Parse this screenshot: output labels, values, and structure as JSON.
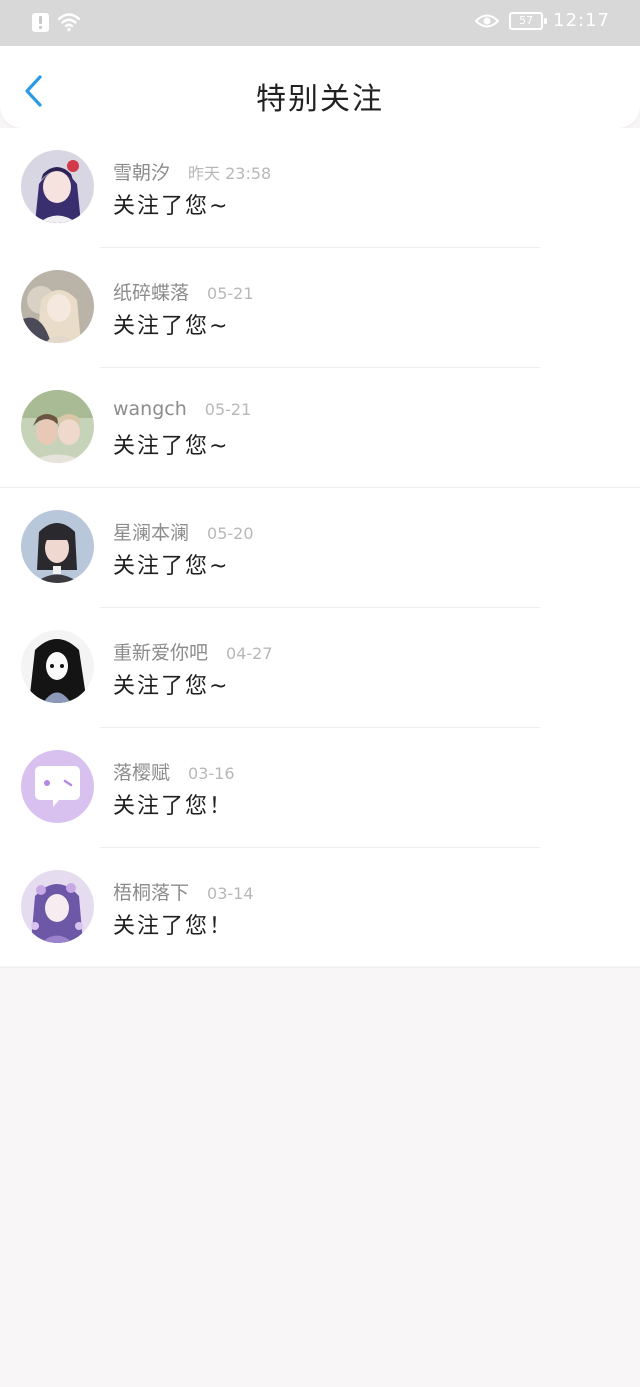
{
  "status_bar": {
    "battery": "57",
    "time": "12:17"
  },
  "nav": {
    "title": "特别关注"
  },
  "items": [
    {
      "name": "雪朝汐",
      "time": "昨天 23:58",
      "message": "关注了您~"
    },
    {
      "name": "纸碎蝶落",
      "time": "05-21",
      "message": "关注了您~"
    },
    {
      "name": "wangch",
      "time": "05-21",
      "message": "关注了您~"
    },
    {
      "name": "星澜本澜",
      "time": "05-20",
      "message": "关注了您~"
    },
    {
      "name": "重新爱你吧",
      "time": "04-27",
      "message": "关注了您~"
    },
    {
      "name": "落樱赋",
      "time": "03-16",
      "message": "关注了您！"
    },
    {
      "name": "梧桐落下",
      "time": "03-14",
      "message": "关注了您！"
    }
  ],
  "colors": {
    "accent": "#2b9be6",
    "status_bar_bg": "#d8d8d8",
    "page_bg": "#f8f6f6"
  }
}
